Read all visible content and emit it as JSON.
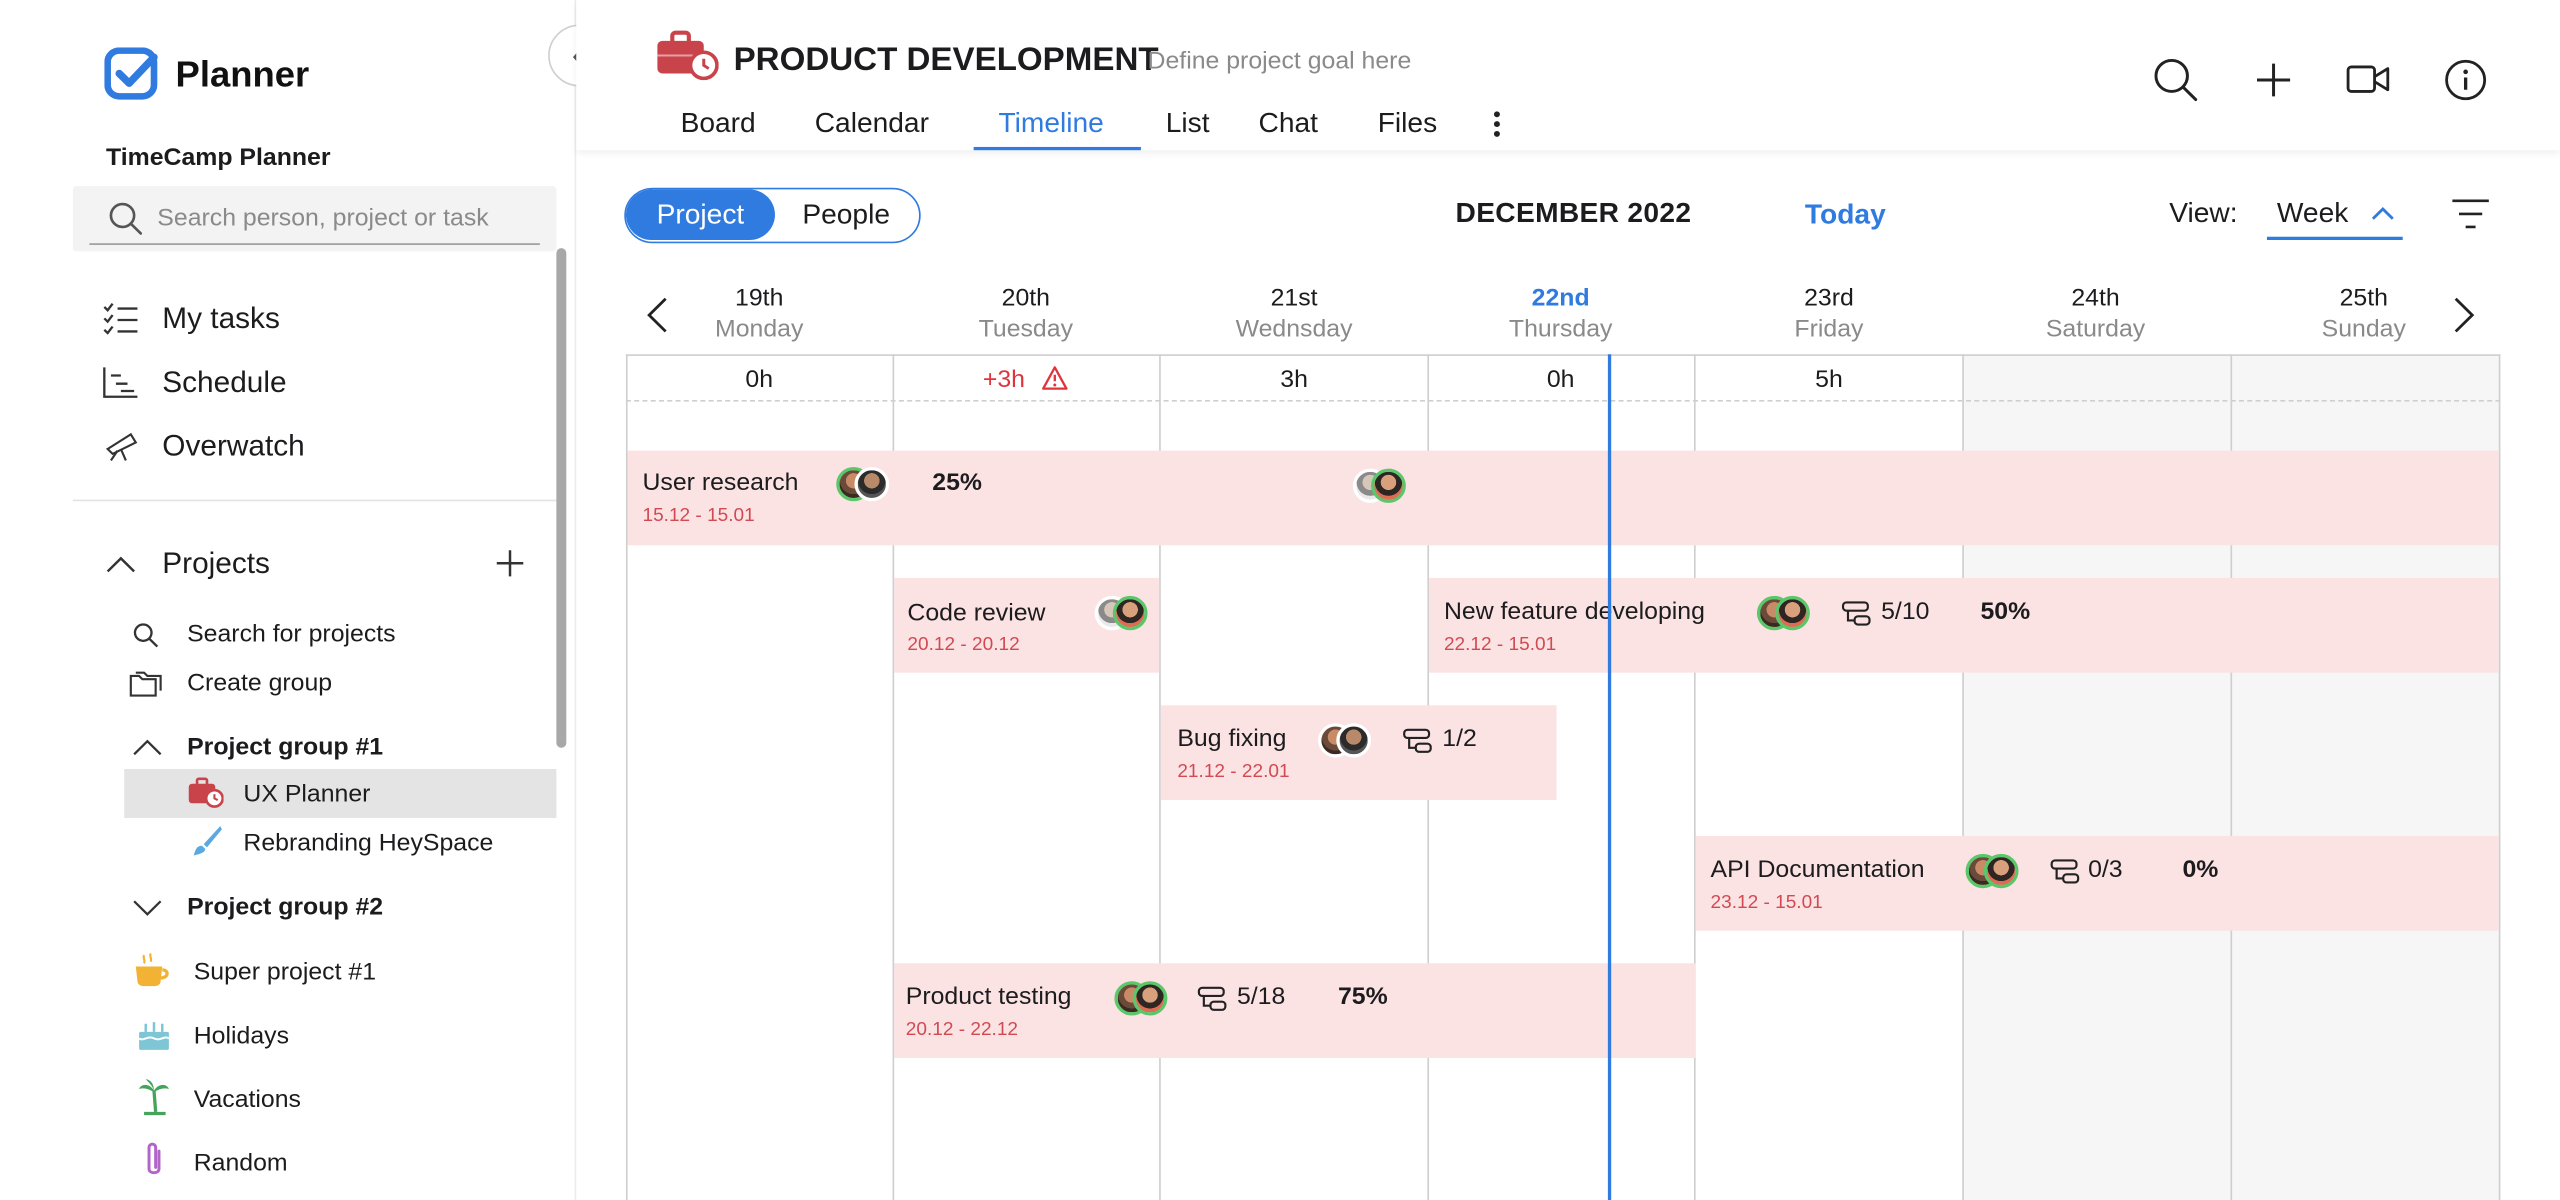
{
  "app": {
    "name": "Planner",
    "workspace": "TimeCamp Planner"
  },
  "sidebar": {
    "search_placeholder": "Search person, project or task",
    "nav": [
      {
        "label": "My tasks",
        "icon": "checklist-icon"
      },
      {
        "label": "Schedule",
        "icon": "schedule-chart-icon"
      },
      {
        "label": "Overwatch",
        "icon": "telescope-icon"
      }
    ],
    "projects_header": "Projects",
    "project_actions": [
      "Search for projects",
      "Create group"
    ],
    "groups": [
      {
        "label": "Project group #1",
        "expanded": true,
        "items": [
          {
            "label": "UX Planner",
            "icon": "briefcase-clock-icon",
            "color": "#c8434a",
            "selected": true
          },
          {
            "label": "Rebranding HeySpace",
            "icon": "brush-icon",
            "color": "#5aa9e0",
            "selected": false
          }
        ]
      },
      {
        "label": "Project group #2",
        "expanded": false,
        "items": [
          {
            "label": "Super project #1",
            "icon": "coffee-cup-icon",
            "color": "#f2b233"
          },
          {
            "label": "Holidays",
            "icon": "cake-icon",
            "color": "#7ec6d6"
          },
          {
            "label": "Vacations",
            "icon": "palm-tree-icon",
            "color": "#46a35b"
          },
          {
            "label": "Random",
            "icon": "paperclip-icon",
            "color": "#b264c9"
          }
        ]
      }
    ]
  },
  "header": {
    "project_title": "PRODUCT DEVELOPMENT",
    "project_goal": "Define project goal here",
    "tabs": [
      "Board",
      "Calendar",
      "Timeline",
      "List",
      "Chat",
      "Files"
    ],
    "active_tab": "Timeline"
  },
  "timeline": {
    "toggle": {
      "options": [
        "Project",
        "People"
      ],
      "selected": "Project"
    },
    "month": "DECEMBER 2022",
    "today_label": "Today",
    "view_label": "View:",
    "view_value": "Week",
    "days": [
      {
        "num": "19th",
        "name": "Monday",
        "hours": "0h"
      },
      {
        "num": "20th",
        "name": "Tuesday",
        "hours": "+3h",
        "overload": true
      },
      {
        "num": "21st",
        "name": "Wednsday",
        "hours": "3h"
      },
      {
        "num": "22nd",
        "name": "Thursday",
        "hours": "0h",
        "today": true
      },
      {
        "num": "23rd",
        "name": "Friday",
        "hours": "5h"
      },
      {
        "num": "24th",
        "name": "Saturday",
        "hours": "",
        "weekend": true
      },
      {
        "num": "25th",
        "name": "Sunday",
        "hours": "",
        "weekend": true
      }
    ],
    "tasks": [
      {
        "name": "User research",
        "dates": "15.12 - 15.01",
        "percent": "25%"
      },
      {
        "name": "Code review",
        "dates": "20.12 - 20.12"
      },
      {
        "name": "New feature developing",
        "dates": "22.12 - 15.01",
        "subtasks": "5/10",
        "percent": "50%"
      },
      {
        "name": "Bug fixing",
        "dates": "21.12 - 22.01",
        "subtasks": "1/2"
      },
      {
        "name": "API Documentation",
        "dates": "23.12 - 15.01",
        "subtasks": "0/3",
        "percent": "0%"
      },
      {
        "name": "Product testing",
        "dates": "20.12 - 22.12",
        "subtasks": "5/18",
        "percent": "75%"
      }
    ]
  },
  "colors": {
    "accent": "#2f7be0",
    "task_bar": "#fbe3e4",
    "task_date": "#d14a52",
    "overload": "#e0343c"
  }
}
